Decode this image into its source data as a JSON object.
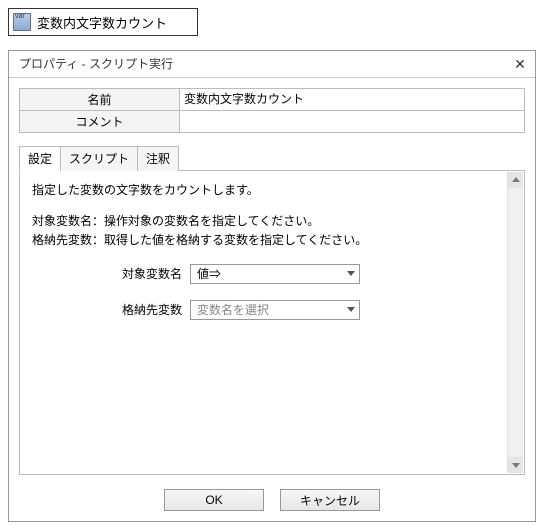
{
  "title": "変数内文字数カウント",
  "dialog": {
    "header": "プロパティ - スクリプト実行",
    "props": {
      "name_label": "名前",
      "name_value": "変数内文字数カウント",
      "comment_label": "コメント",
      "comment_value": ""
    },
    "tabs": {
      "settings": "設定",
      "script": "スクリプト",
      "note": "注釈"
    },
    "panel": {
      "line1": "指定した変数の文字数をカウントします。",
      "line2": "対象変数名：操作対象の変数名を指定してください。",
      "line3": "格納先変数：取得した値を格納する変数を指定してください。",
      "field1_label": "対象変数名",
      "field1_value": "値⇒",
      "field2_label": "格納先変数",
      "field2_placeholder": "変数名を選択"
    },
    "buttons": {
      "ok": "OK",
      "cancel": "キャンセル"
    }
  }
}
